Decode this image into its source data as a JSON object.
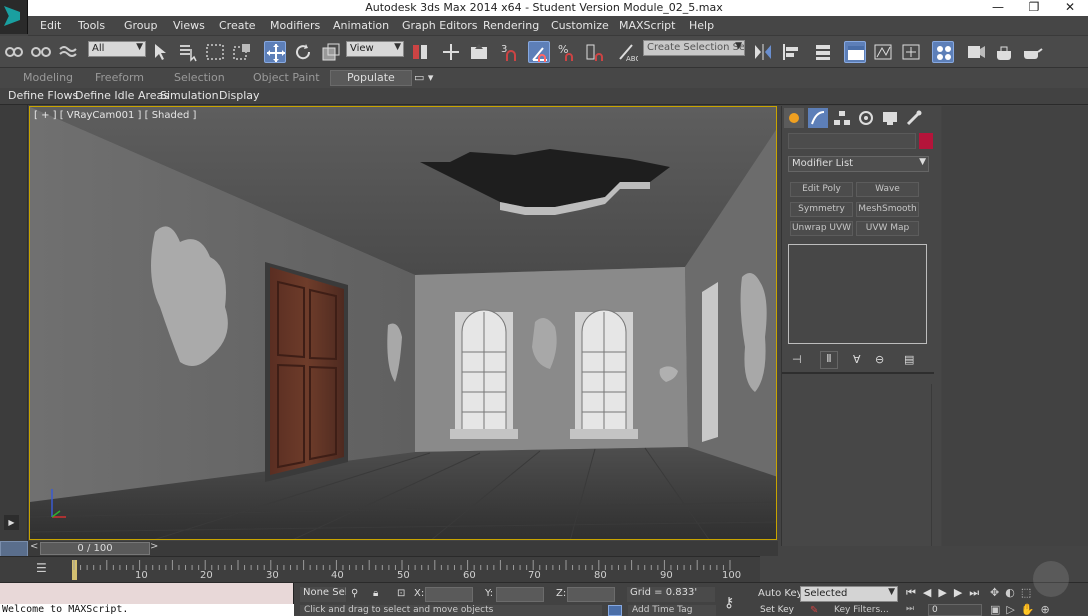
{
  "window": {
    "title": "Autodesk 3ds Max  2014 x64  - Student Version   Module_02_5.max",
    "minimize": "—",
    "restore": "❐",
    "close": "✕"
  },
  "menu": [
    "Edit",
    "Tools",
    "Group",
    "Views",
    "Create",
    "Modifiers",
    "Animation",
    "Graph Editors",
    "Rendering",
    "Customize",
    "MAXScript",
    "Help"
  ],
  "toolbar": {
    "selection_filter": "All",
    "ref_coord": "View",
    "snap_value": "3",
    "named_selection_placeholder": "Create Selection Se"
  },
  "ribbon": {
    "tabs": [
      "Modeling",
      "Freeform",
      "Selection",
      "Object Paint",
      "Populate"
    ],
    "active_tab": "Populate",
    "sub_tabs": [
      "Define Flows",
      "Define Idle Areas",
      "Simulation",
      "Display"
    ]
  },
  "viewport": {
    "label": "[ + ] [ VRayCam001 ] [ Shaded ]",
    "border_color": "#c8a400"
  },
  "command_panel": {
    "modifier_list": "Modifier List",
    "object_color": "#b5143a",
    "modifier_buttons": [
      "Edit Poly",
      "Wave",
      "Symmetry",
      "MeshSmooth",
      "Unwrap UVW",
      "UVW Map"
    ]
  },
  "timeline": {
    "slider_label": "0 / 100",
    "prev": "<",
    "next": ">",
    "ticks": [
      "10",
      "20",
      "30",
      "40",
      "50",
      "60",
      "70",
      "80",
      "90",
      "100"
    ]
  },
  "status": {
    "maxscript_output": "Welcome to MAXScript.",
    "selection_info": "None Sele",
    "x_label": "X:",
    "y_label": "Y:",
    "z_label": "Z:",
    "grid": "Grid = 0.833'",
    "prompt": "Click and drag to select and move objects",
    "add_time_tag": "Add Time Tag",
    "auto_key": "Auto Key",
    "set_key": "Set Key",
    "key_mode": "Selected",
    "key_filters": "Key Filters...",
    "frame": "0"
  }
}
